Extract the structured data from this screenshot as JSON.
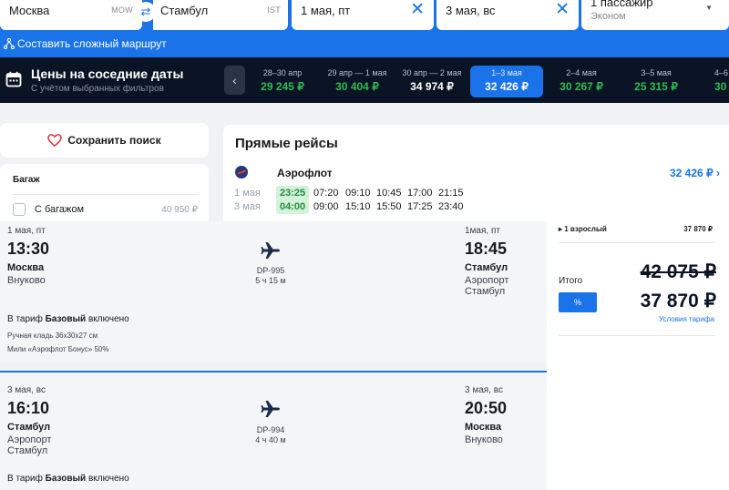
{
  "search": {
    "from_city": "Москва",
    "from_code": "MOW",
    "to_city": "Стамбул",
    "to_code": "IST",
    "date_there": "1 мая, пт",
    "date_back": "3 мая, вс",
    "passengers": "1 пассажир",
    "cabin_class": "Эконом",
    "complex_route": "Составить сложный маршрут"
  },
  "nearby_dates": {
    "title": "Цены на соседние даты",
    "subtitle": "С учётом выбранных фильтров",
    "items": [
      {
        "dates": "28–30 апр",
        "price": "29 245 ₽"
      },
      {
        "dates": "29 апр — 1 мая",
        "price": "30 404 ₽"
      },
      {
        "dates": "30 апр — 2 мая",
        "price": "34 974 ₽"
      },
      {
        "dates": "1–3 мая",
        "price": "32 426 ₽"
      },
      {
        "dates": "2–4 мая",
        "price": "30 267 ₽"
      },
      {
        "dates": "3–5 мая",
        "price": "25 315 ₽"
      },
      {
        "dates": "4–6",
        "price": "30"
      }
    ]
  },
  "sidebar": {
    "save_search": "Сохранить поиск",
    "baggage_title": "Багаж",
    "baggage_option": "С багажом",
    "baggage_price": "40 950 ₽"
  },
  "direct": {
    "title": "Прямые рейсы",
    "airline": "Аэрофлот",
    "price": "32 426 ₽",
    "rows": [
      {
        "date": "1 мая",
        "times": [
          "23:25",
          "07:20",
          "09:10",
          "10:45",
          "17:00",
          "21:15"
        ]
      },
      {
        "date": "3 мая",
        "times": [
          "04:00",
          "09:00",
          "15:10",
          "15:50",
          "17:25",
          "23:40"
        ]
      }
    ]
  },
  "segments": [
    {
      "dep_date": "1 мая, пт",
      "dep_time": "13:30",
      "dep_city": "Москва",
      "dep_airport": "Внуково",
      "arr_date": "1мая, пт",
      "arr_time": "18:45",
      "arr_city": "Стамбул",
      "arr_airport": "Аэропорт Стамбул",
      "flight_code": "DP-995",
      "duration": "5 ч 15 м",
      "tariff_prefix": "В тариф",
      "tariff_name": "Базовый",
      "tariff_suffix": "включено",
      "note1": "Ручная кладь 36x30x27 см",
      "note2": "Мили «Аэрофлот Бонус» 50%"
    },
    {
      "dep_date": "3 мая, вс",
      "dep_time": "16:10",
      "dep_city": "Стамбул",
      "dep_airport": "Аэропорт Стамбул",
      "arr_date": "3 мая, вс",
      "arr_time": "20:50",
      "arr_city": "Москва",
      "arr_airport": "Внуково",
      "flight_code": "DP-994",
      "duration": "4 ч 40 м",
      "tariff_prefix": "В тариф",
      "tariff_name": "Базовый",
      "tariff_suffix": "включено"
    }
  ],
  "summary": {
    "pax": "1 взрослый",
    "pax_price": "37 870 ₽",
    "total_label": "Итого",
    "old_price": "42 075 ₽",
    "discount_badge": "%",
    "new_price": "37 870 ₽",
    "conditions_link": "Условия тарифа"
  },
  "colors": {
    "accent": "#1a73e8",
    "dark_strip": "#0b1424",
    "green_price": "#2bbd53"
  }
}
